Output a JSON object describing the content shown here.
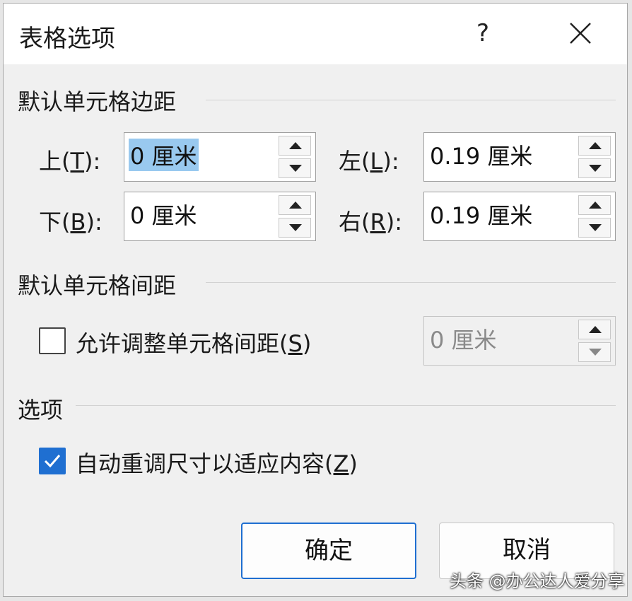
{
  "dialog": {
    "title": "表格选项",
    "help_label": "?"
  },
  "margins": {
    "section_title": "默认单元格边距",
    "top": {
      "label": "上(",
      "key": "T",
      "suffix": "):",
      "value": "0 厘米"
    },
    "bottom": {
      "label": "下(",
      "key": "B",
      "suffix": "):",
      "value": "0 厘米"
    },
    "left": {
      "label": "左(",
      "key": "L",
      "suffix": "):",
      "value": "0.19 厘米"
    },
    "right": {
      "label": "右(",
      "key": "R",
      "suffix": "):",
      "value": "0.19 厘米"
    }
  },
  "spacing": {
    "section_title": "默认单元格间距",
    "allow_label": "允许调整单元格间距(",
    "allow_key": "S",
    "allow_suffix": ")",
    "allow_checked": false,
    "value": "0 厘米"
  },
  "options": {
    "section_title": "选项",
    "autofit_label": "自动重调尺寸以适应内容(",
    "autofit_key": "Z",
    "autofit_suffix": ")",
    "autofit_checked": true
  },
  "buttons": {
    "ok": "确定",
    "cancel": "取消"
  },
  "watermark": "头条 @办公达人爱分享",
  "colors": {
    "accent": "#1f6fd1",
    "selection": "#99c9ef"
  }
}
